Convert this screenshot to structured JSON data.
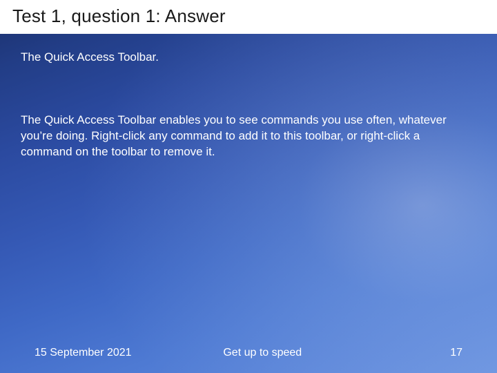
{
  "slide": {
    "title": "Test 1, question 1: Answer",
    "answer_short": "The Quick Access Toolbar.",
    "answer_explain": "The Quick Access Toolbar enables you to see commands you use often, whatever you’re doing. Right-click any command to add it to this toolbar, or right-click a command on the toolbar to remove it."
  },
  "footer": {
    "date": "15 September 2021",
    "center": "Get up to speed",
    "page": "17"
  }
}
